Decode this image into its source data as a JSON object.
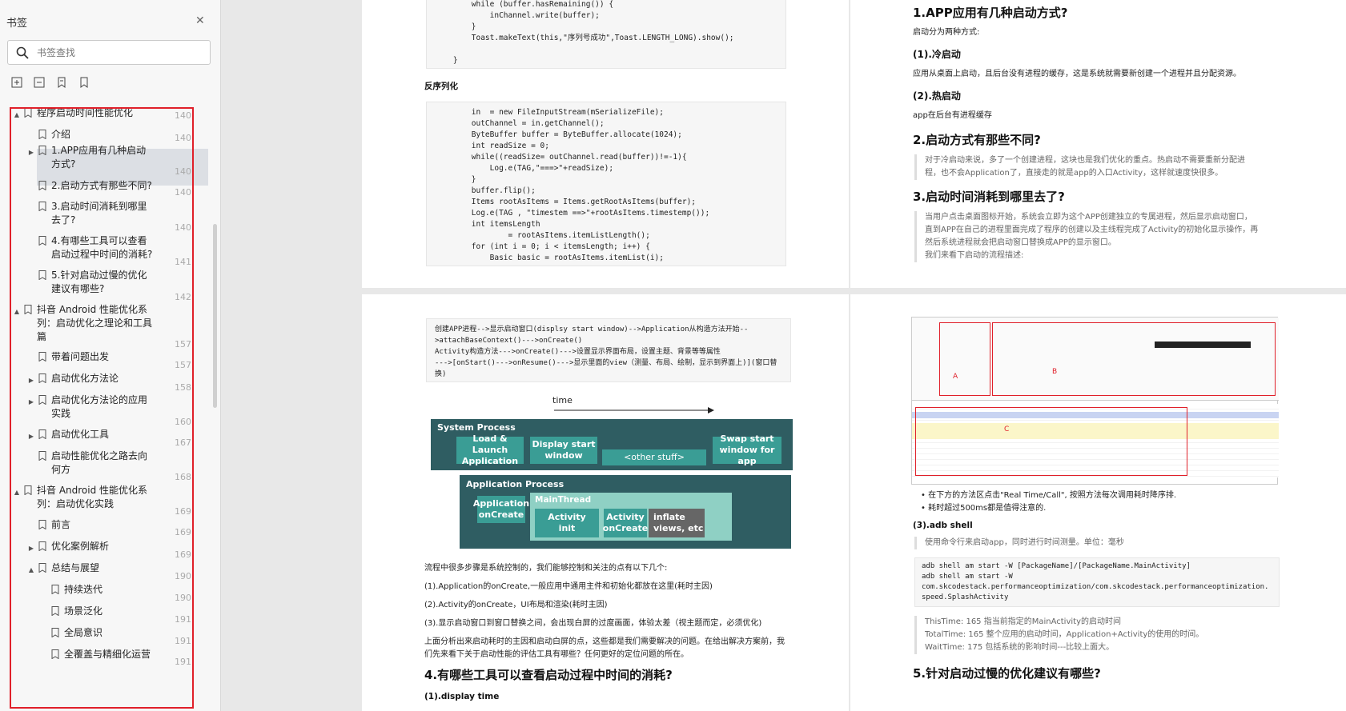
{
  "sidebar": {
    "title": "书签",
    "search_placeholder": "书签查找",
    "items": [
      {
        "label": "程序启动时间性能优化",
        "page": "140"
      },
      {
        "label": "介绍",
        "page": "140"
      },
      {
        "label": "1.APP应用有几种启动方式?",
        "page": "140"
      },
      {
        "label": "2.启动方式有那些不同?",
        "page": "140"
      },
      {
        "label": "3.启动时间消耗到哪里去了?",
        "page": "140"
      },
      {
        "label": "4.有哪些工具可以查看启动过程中时间的消耗?",
        "page": "141"
      },
      {
        "label": "5.针对启动过慢的优化建议有哪些?",
        "page": "142"
      },
      {
        "label": "抖音 Android 性能优化系列：启动优化之理论和工具篇",
        "page": "157"
      },
      {
        "label": "带着问题出发",
        "page": "157"
      },
      {
        "label": "启动优化方法论",
        "page": "158"
      },
      {
        "label": "启动优化方法论的应用实践",
        "page": "160"
      },
      {
        "label": "启动优化工具",
        "page": "167"
      },
      {
        "label": "启动性能优化之路去向何方",
        "page": "168"
      },
      {
        "label": "抖音 Android 性能优化系列：启动优化实践",
        "page": "169"
      },
      {
        "label": "前言",
        "page": "169"
      },
      {
        "label": "优化案例解析",
        "page": "169"
      },
      {
        "label": "总结与展望",
        "page": "190"
      },
      {
        "label": "持续迭代",
        "page": "190"
      },
      {
        "label": "场景泛化",
        "page": "191"
      },
      {
        "label": "全局意识",
        "page": "191"
      },
      {
        "label": "全覆盖与精细化运营",
        "page": "191"
      }
    ]
  },
  "page1": {
    "code_top": "        while (buffer.hasRemaining()) {\n            inChannel.write(buffer);\n        }\n        Toast.makeText(this,\"序列号成功\",Toast.LENGTH_LONG).show();\n\n    }",
    "heading": "反序列化",
    "code_main": "        in  = new FileInputStream(mSerializeFile);\n        outChannel = in.getChannel();\n        ByteBuffer buffer = ByteBuffer.allocate(1024);\n        int readSize = 0;\n        while((readSize= outChannel.read(buffer))!=-1){\n            Log.e(TAG,\"===>\"+readSize);\n        }\n        buffer.flip();\n        Items rootAsItems = Items.getRootAsItems(buffer);\n        Log.e(TAG , \"timestem ==>\"+rootAsItems.timestemp());\n        int itemsLength\n                = rootAsItems.itemListLength();\n        for (int i = 0; i < itemsLength; i++) {\n            Basic basic = rootAsItems.itemList(i);"
  },
  "page2": {
    "h1": "1.APP应用有几种启动方式?",
    "p1": "启动分为两种方式:",
    "h_cold": "(1).冷启动",
    "p_cold": "应用从桌面上启动，且后台没有进程的缓存，这是系统就需要新创建一个进程并且分配资源。",
    "h_hot": "(2).热启动",
    "p_hot": "app在后台有进程缓存",
    "h2": "2.启动方式有那些不同?",
    "q2": "对于冷启动来说，多了一个创建进程，这块也是我们优化的重点。热启动不需要重新分配进程，也不会Application了，直接走的就是app的入口Activity，这样就速度快很多。",
    "h3": "3.启动时间消耗到哪里去了?",
    "q3": "当用户点击桌面图标开始，系统会立即为这个APP创建独立的专属进程，然后显示启动窗口，直到APP在自己的进程里面完成了程序的创建以及主线程完成了Activity的初始化显示操作，再然后系统进程就会把启动窗口替换成APP的显示窗口。",
    "q3b": "我们来看下启动的流程描述:"
  },
  "page3": {
    "code": "创建APP进程-->显示启动窗口(displsy start window)-->Application从构造方法开始--\n>attachBaseContext()--->onCreate()\nActivity构造方法--->onCreate()--->设置显示界面布局，设置主题、背景等等属性\n--->[onStart()--->onResume()--->显示里面的view（测量、布局、绘制，显示到界面上)](窗口替\n换)",
    "time_label": "time",
    "system_process": "System Process",
    "load_launch": "Load & Launch Application",
    "display_start": "Display start window",
    "other_stuff": "<other stuff>",
    "swap_start": "Swap start window for app",
    "application_process": "Application Process",
    "app_oncreate": "Application onCreate",
    "main_thread": "MainThread",
    "activity_init": "Activity init",
    "activity_oncreate": "Activity onCreate",
    "inflate_views": "inflate views, etc",
    "p1": "流程中很多步骤是系统控制的，我们能够控制和关注的点有以下几个:",
    "p2": "(1).Application的onCreate,一般应用中通用主件和初始化都放在这里(耗时主因)",
    "p3": "(2).Activity的onCreate，UI布局和渲染(耗时主因)",
    "p4": "(3).显示启动窗口到窗口替换之间，会出现白屏的过度画面，体验太差（视主题而定，必须优化)",
    "p5": "上面分析出来启动耗时的主因和启动白屏的点，这些都是我们需要解决的问题。在给出解决方案前，我们先来看下关于启动性能的评估工具有哪些？任何更好的定位问题的所在。",
    "h4": "4.有哪些工具可以查看启动过程中时间的消耗?",
    "h_display": "(1).display time"
  },
  "page4": {
    "label_a": "A",
    "label_b": "B",
    "label_c": "C",
    "bullet1": "在下方的方法区点击\"Real Time/Call\", 按照方法每次调用耗时降序排.",
    "bullet2": "耗时超过500ms都是值得注意的.",
    "h_adb": "(3).adb shell",
    "q_adb": "使用命令行来启动app，同时进行时间测量。单位：毫秒",
    "code_adb": "adb shell am start -W [PackageName]/[PackageName.MainActivity]\nadb shell am start -W\ncom.skcodestack.performanceoptimization/com.skcodestack.performanceoptimization.\nspeed.SplashActivity",
    "q_this": "ThisTime: 165 指当前指定的MainActivity的启动时间",
    "q_total": "TotalTime: 165 整个应用的启动时间，Application+Activity的使用的时间。",
    "q_wait": "WaitTime: 175 包括系统的影响时间---比较上面大。",
    "h5": "5.针对启动过慢的优化建议有哪些?"
  },
  "colors": {
    "red_outline": "#e0202a",
    "diagram_dark": "#2f5d62",
    "diagram_light": "#3a9d95"
  }
}
